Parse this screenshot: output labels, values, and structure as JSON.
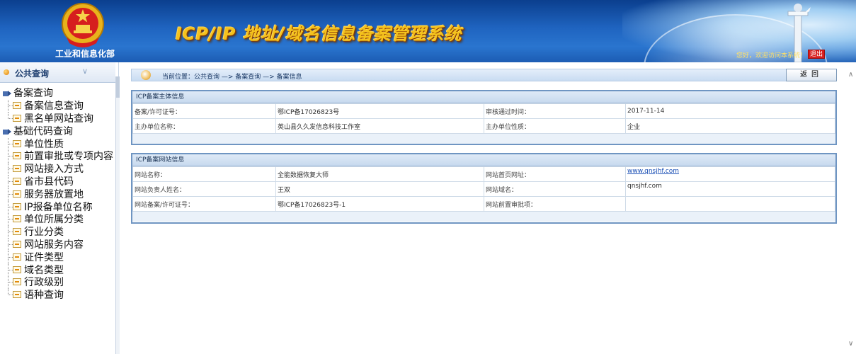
{
  "header": {
    "ministry_name": "工业和信息化部",
    "system_title": "ICP/IP 地址/域名信息备案管理系统",
    "welcome_text": "您好，欢迎访问本系统！",
    "logout_label": "退出"
  },
  "sidebar": {
    "title": "公共查询",
    "groups": [
      {
        "label": "备案查询",
        "items": [
          "备案信息查询",
          "黑名单网站查询"
        ]
      },
      {
        "label": "基础代码查询",
        "items": [
          "单位性质",
          "前置审批或专项内容",
          "网站接入方式",
          "省市县代码",
          "服务器放置地",
          "IP报备单位名称",
          "单位所属分类",
          "行业分类",
          "网站服务内容",
          "证件类型",
          "域名类型",
          "行政级别",
          "语种查询"
        ]
      }
    ]
  },
  "breadcrumb": {
    "text": "当前位置：公共查询 —> 备案查询 —> 备案信息"
  },
  "back_button_label": "返回",
  "subject_panel": {
    "title": "ICP备案主体信息",
    "rows": [
      {
        "label1": "备案/许可证号：",
        "value1": "鄂ICP备17026823号",
        "label2": "审核通过时间：",
        "value2": "2017-11-14"
      },
      {
        "label1": "主办单位名称：",
        "value1": "英山县久久发信息科技工作室",
        "label2": "主办单位性质：",
        "value2": "企业"
      }
    ]
  },
  "site_panel": {
    "title": "ICP备案网站信息",
    "rows": [
      {
        "label1": "网站名称：",
        "value1": "全能数据恢复大师",
        "label2": "网站首页网址：",
        "value2": "www.qnsjhf.com"
      },
      {
        "label1": "网站负责人姓名：",
        "value1": "王双",
        "label2": "网站域名：",
        "value2": "qnsjhf.com"
      },
      {
        "label1": "网站备案/许可证号：",
        "value1": "鄂ICP备17026823号-1",
        "label2": "网站前置审批项：",
        "value2": ""
      }
    ]
  },
  "colors": {
    "header_blue": "#1f64c0",
    "title_gold": "#f4c21d",
    "panel_border": "#6f95c2",
    "logout_red": "#d81e1e"
  }
}
